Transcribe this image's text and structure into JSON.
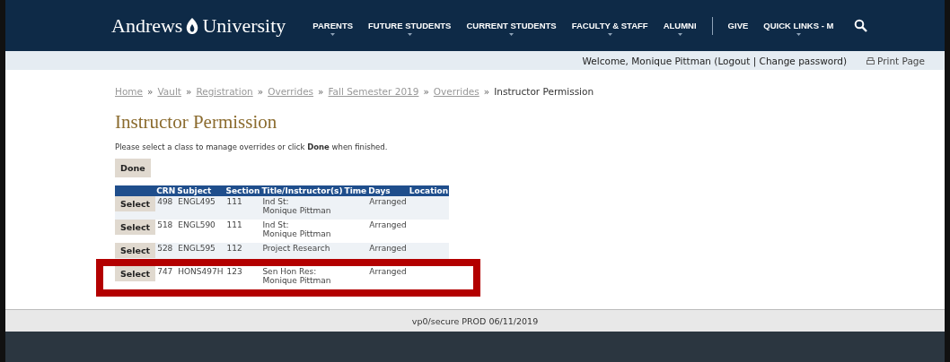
{
  "header": {
    "logo": [
      "Andrews",
      "University"
    ],
    "nav": [
      {
        "kind": "menu",
        "label": "PARENTS"
      },
      {
        "kind": "menu",
        "label": "FUTURE STUDENTS"
      },
      {
        "kind": "menu",
        "label": "CURRENT STUDENTS"
      },
      {
        "kind": "menu",
        "label": "FACULTY & STAFF"
      },
      {
        "kind": "menu",
        "label": "ALUMNI"
      },
      {
        "kind": "divider"
      },
      {
        "kind": "link",
        "label": "GIVE"
      },
      {
        "kind": "menu",
        "label": "QUICK LINKS - M"
      }
    ]
  },
  "user_bar": {
    "welcome": "Welcome, Monique Pittman (Logout | Change password)",
    "print": "Print Page"
  },
  "breadcrumb": {
    "separator": "»",
    "items": [
      {
        "kind": "link",
        "label": "Home"
      },
      {
        "kind": "link",
        "label": "Vault"
      },
      {
        "kind": "link",
        "label": "Registration"
      },
      {
        "kind": "link",
        "label": "Overrides"
      },
      {
        "kind": "link",
        "label": "Fall Semester 2019"
      },
      {
        "kind": "link",
        "label": "Overrides"
      },
      {
        "kind": "current",
        "label": "Instructor Permission"
      }
    ]
  },
  "title": "Instructor Permission",
  "instructions": "Please select a class to manage overrides or click **Done** when finished.",
  "done_button": "Done",
  "table": {
    "columns": [
      "CRN",
      "Subject",
      "Section",
      "Title/Instructor(s)",
      "Time",
      "Days",
      "Location"
    ],
    "rows": [
      {
        "button": "Select",
        "cells": [
          "498",
          "ENGL495",
          "111",
          [
            "Ind St:",
            "Monique Pittman"
          ],
          "",
          "Arranged",
          ""
        ],
        "kind": "plain"
      },
      {
        "button": "Select",
        "cells": [
          "518",
          "ENGL590",
          "111",
          [
            "Ind St:",
            "Monique Pittman"
          ],
          "",
          "Arranged",
          ""
        ],
        "kind": "plain"
      },
      {
        "button": "Select",
        "cells": [
          "528",
          "ENGL595",
          "112",
          [
            "Project Research"
          ],
          "",
          "Arranged",
          ""
        ],
        "kind": "plain"
      },
      {
        "button": "Select",
        "cells": [
          "747",
          "HONS497H",
          "123",
          [
            "Sen Hon Res:",
            "Monique Pittman"
          ],
          "",
          "Arranged",
          ""
        ],
        "kind": "highlighted"
      }
    ]
  },
  "footer": "vp0/secure PROD 06/11/2019"
}
